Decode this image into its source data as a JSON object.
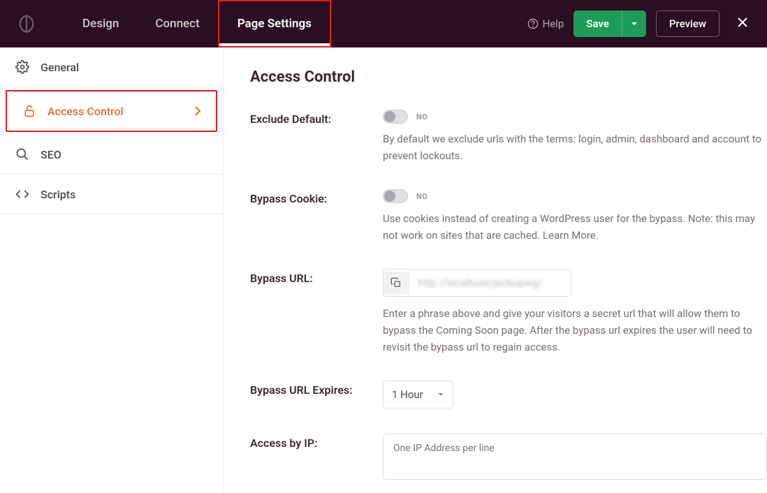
{
  "header": {
    "tabs": [
      {
        "label": "Design"
      },
      {
        "label": "Connect"
      },
      {
        "label": "Page Settings"
      }
    ],
    "help_label": "Help",
    "save_label": "Save",
    "preview_label": "Preview"
  },
  "sidebar": {
    "items": [
      {
        "label": "General"
      },
      {
        "label": "Access Control"
      },
      {
        "label": "SEO"
      },
      {
        "label": "Scripts"
      }
    ]
  },
  "main": {
    "title": "Access Control",
    "exclude_default": {
      "label": "Exclude Default:",
      "state": "NO",
      "desc": "By default we exclude urls with the terms: login, admin, dashboard and account to prevent lockouts."
    },
    "bypass_cookie": {
      "label": "Bypass Cookie:",
      "state": "NO",
      "desc": "Use cookies instead of creating a WordPress user for the bypass. Note: this may not work on sites that are cached. Learn More."
    },
    "bypass_url": {
      "label": "Bypass URL:",
      "value": "http://localhost/pickupwg/",
      "desc": "Enter a phrase above and give your visitors a secret url that will allow them to bypass the Coming Soon page. After the bypass url expires the user will need to revisit the bypass url to regain access."
    },
    "bypass_expires": {
      "label": "Bypass URL Expires:",
      "value": "1 Hour"
    },
    "access_by_ip": {
      "label": "Access by IP:",
      "placeholder": "One IP Address per line"
    }
  }
}
